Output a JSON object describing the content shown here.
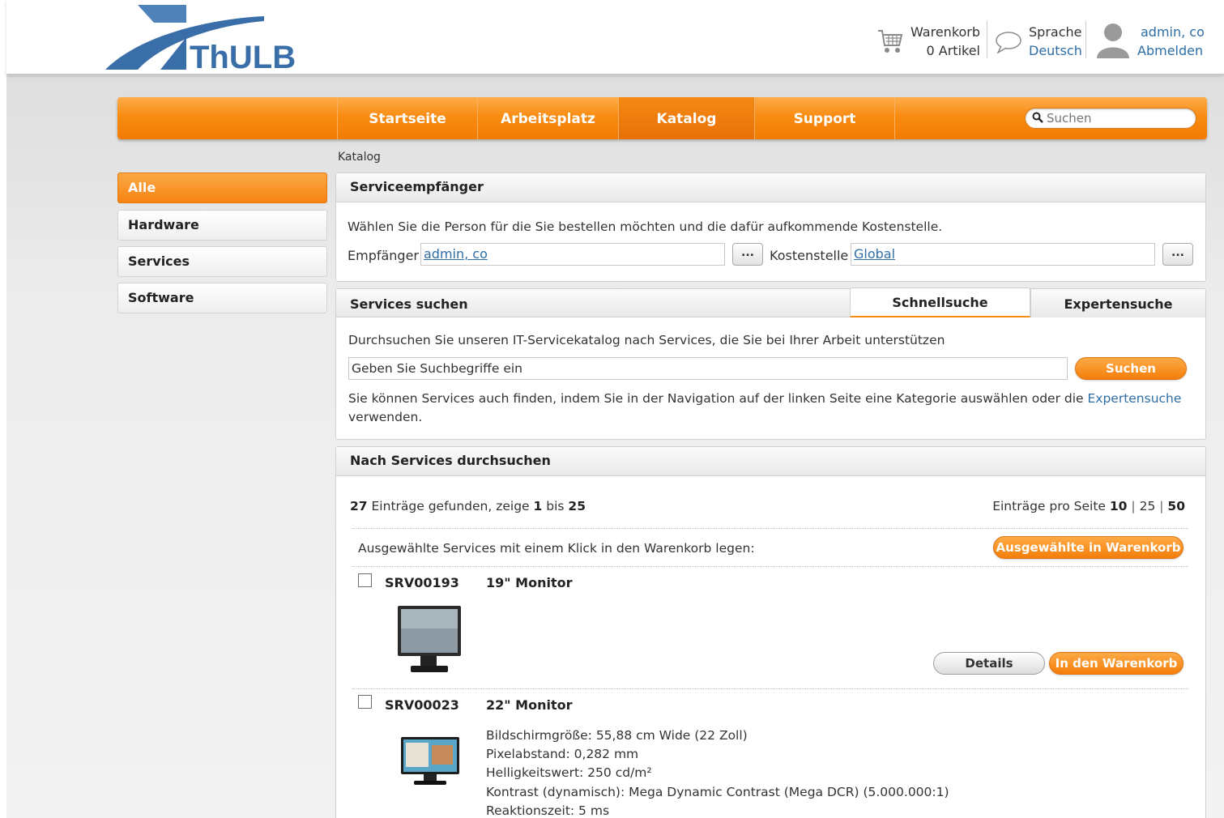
{
  "header": {
    "logo_text": "ThULB",
    "cart_label": "Warenkorb",
    "cart_count": "0 Artikel",
    "language_label": "Sprache",
    "language_value": "Deutsch",
    "user_name": "admin, co",
    "logout": "Abmelden"
  },
  "nav": {
    "items": [
      "Startseite",
      "Arbeitsplatz",
      "Katalog",
      "Support"
    ],
    "active": "Katalog",
    "search_placeholder": "Suchen"
  },
  "breadcrumb": "Katalog",
  "sidebar": {
    "items": [
      "Alle",
      "Hardware",
      "Services",
      "Software"
    ],
    "active": "Alle"
  },
  "recipient": {
    "title": "Serviceempfänger",
    "description": "Wählen Sie die Person für die Sie bestellen möchten und die dafür aufkommende Kostenstelle.",
    "recipient_label": "Empfänger",
    "recipient_value": "admin, co",
    "cost_center_label": "Kostenstelle",
    "cost_center_value": "Global",
    "picker_label": "..."
  },
  "search": {
    "title": "Services suchen",
    "tab_quick": "Schnellsuche",
    "tab_expert": "Expertensuche",
    "intro": "Durchsuchen Sie unseren IT-Servicekatalog nach Services, die Sie bei Ihrer Arbeit unterstützen",
    "input_value": "Geben Sie Suchbegriffe ein",
    "button": "Suchen",
    "hint_part1": "Sie können Services auch finden, indem Sie in der Navigation auf der linken Seite eine Kategorie auswählen oder die",
    "hint_link": "Expertensuche",
    "hint_part2": "verwenden."
  },
  "browse": {
    "title": "Nach Services durchsuchen",
    "count_total": "27",
    "count_text1": "Einträge gefunden, zeige",
    "count_from": "1",
    "count_text2": "bis",
    "count_to": "25",
    "per_page_label": "Einträge pro Seite",
    "per_page_options": [
      "10",
      "25",
      "50"
    ],
    "bulk_text": "Ausgewählte Services mit einem Klick in den Warenkorb legen:",
    "bulk_button": "Ausgewählte in Warenkorb",
    "items": [
      {
        "id": "SRV00193",
        "name": "19\" Monitor",
        "details_button": "Details",
        "cart_button": "In den Warenkorb",
        "specs": []
      },
      {
        "id": "SRV00023",
        "name": "22\" Monitor",
        "specs": [
          "Bildschirmgröße: 55,88 cm Wide (22 Zoll)",
          "Pixelabstand: 0,282 mm",
          "Helligkeitswert: 250 cd/m²",
          "Kontrast (dynamisch): Mega Dynamic Contrast (Mega DCR) (5.000.000:1)",
          "Reaktionszeit: 5 ms"
        ]
      }
    ]
  },
  "colors": {
    "accent": "#f88c12",
    "link": "#2e6ea6",
    "logo_blue": "#3a6ea9"
  }
}
